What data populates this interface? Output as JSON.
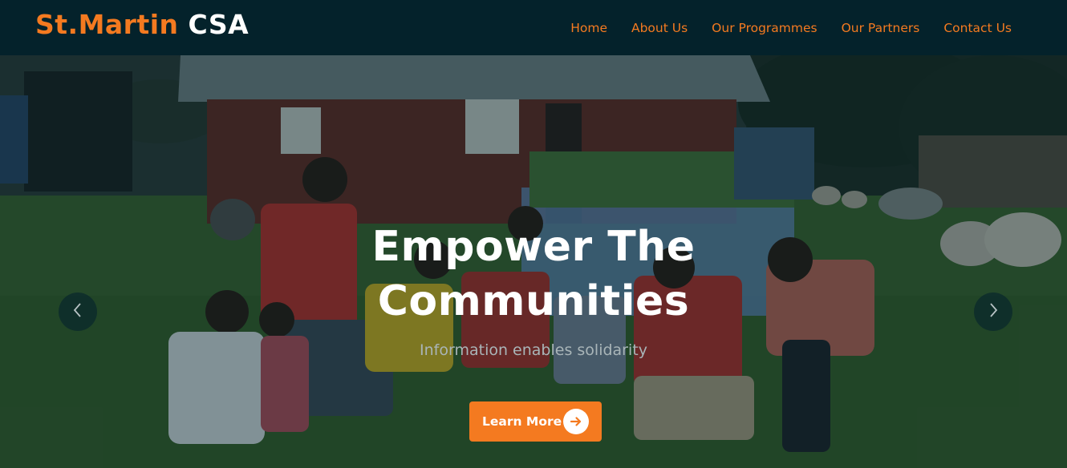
{
  "brand": {
    "part1": "St.Martin",
    "part2": "CSA"
  },
  "nav": {
    "items": [
      {
        "label": "Home"
      },
      {
        "label": "About Us"
      },
      {
        "label": "Our Programmes"
      },
      {
        "label": "Our Partners"
      },
      {
        "label": "Contact Us"
      }
    ]
  },
  "hero": {
    "title_line1": "Empower The",
    "title_line2": "Communities",
    "subtitle": "Information enables solidarity",
    "cta_label": "Learn More",
    "cta_icon": "arrow-right-circle-icon",
    "prev_icon": "chevron-left-icon",
    "next_icon": "chevron-right-icon",
    "background": "photo of children posing on grass in front of a red house with sheep"
  },
  "colors": {
    "accent": "#f47a20",
    "navbar": "#04222b",
    "title": "#ffffff"
  }
}
